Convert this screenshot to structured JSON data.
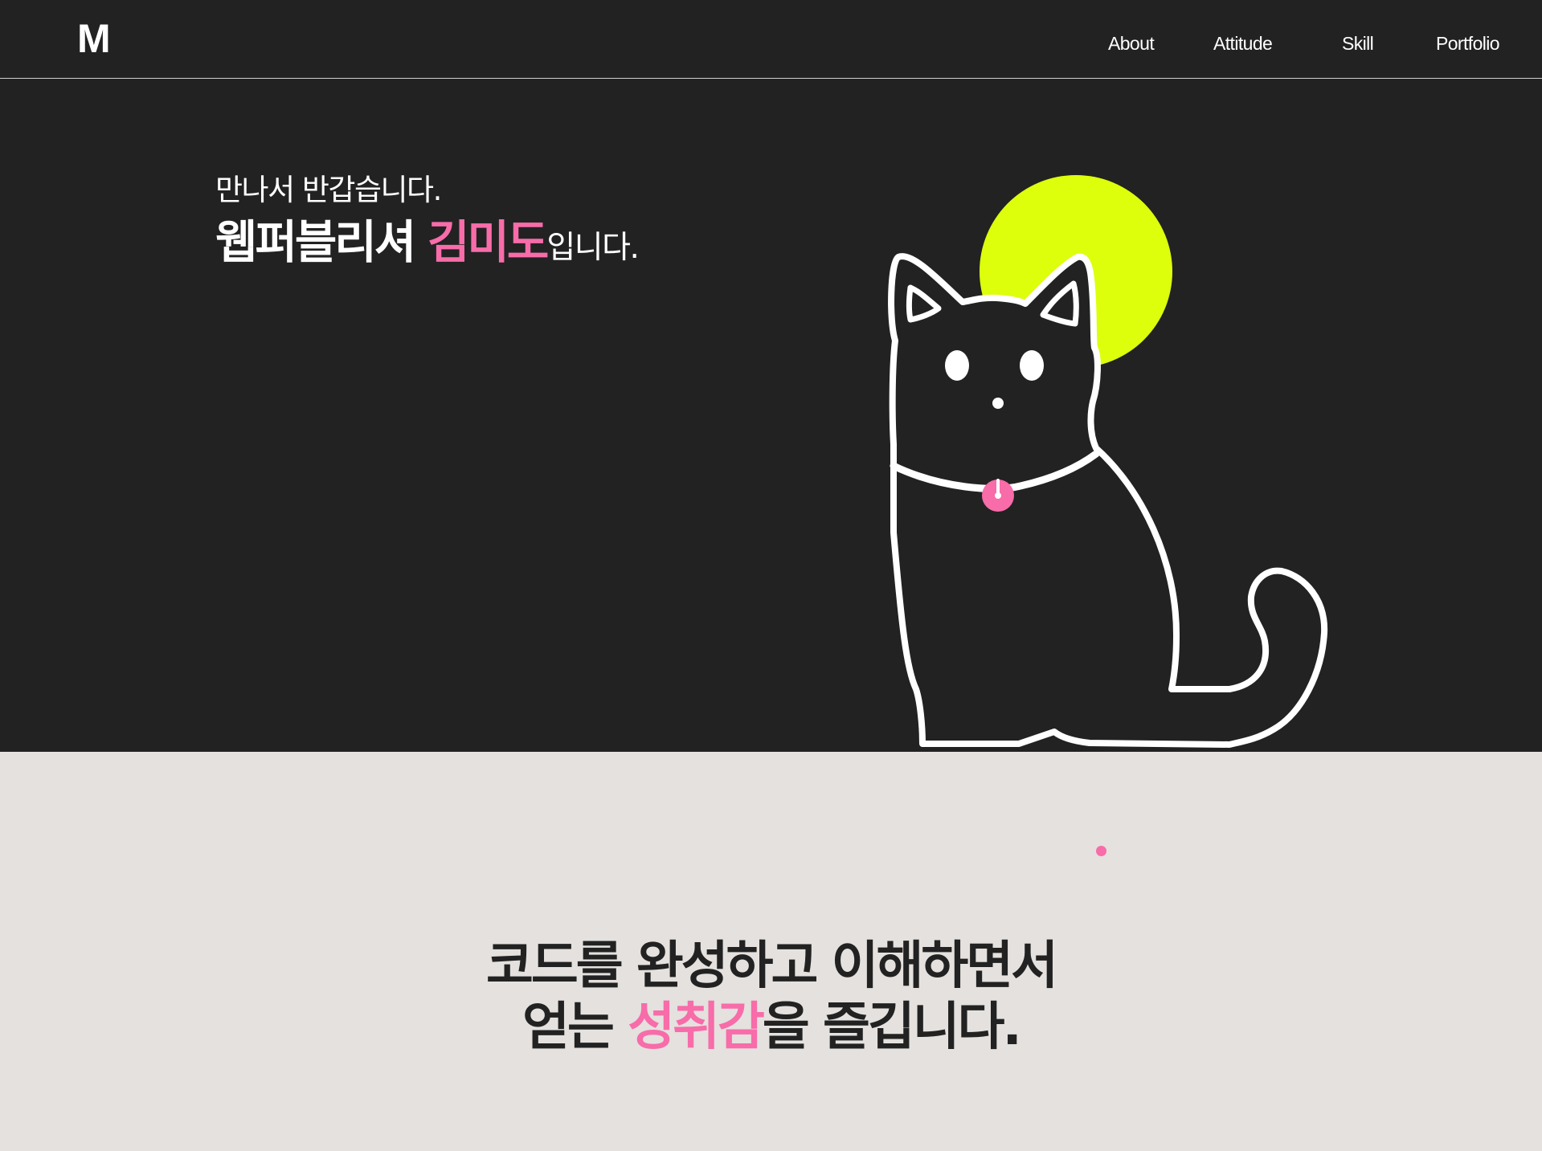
{
  "header": {
    "logo": "M",
    "nav": [
      "About",
      "Attitude",
      "Skill",
      "Portfolio"
    ]
  },
  "hero": {
    "greeting": "만나서 반갑습니다.",
    "title_prefix": "웹퍼블리셔 ",
    "name": "김미도",
    "title_suffix": "입니다."
  },
  "quote": {
    "line1": "코드를 완성하고 이해하면서",
    "line2_prefix": "얻는 ",
    "line2_highlight": "성취감",
    "line2_suffix": "을 즐깁니다."
  },
  "colors": {
    "dark": "#222222",
    "light": "#E4E1DE",
    "accent_pink": "#F76CA9",
    "accent_lime": "#DDFF0C",
    "white": "#FFFFFF"
  },
  "icons": {
    "illustration": "cat-illustration",
    "moon": "moon-circle",
    "collar_tag": "collar-tag"
  }
}
